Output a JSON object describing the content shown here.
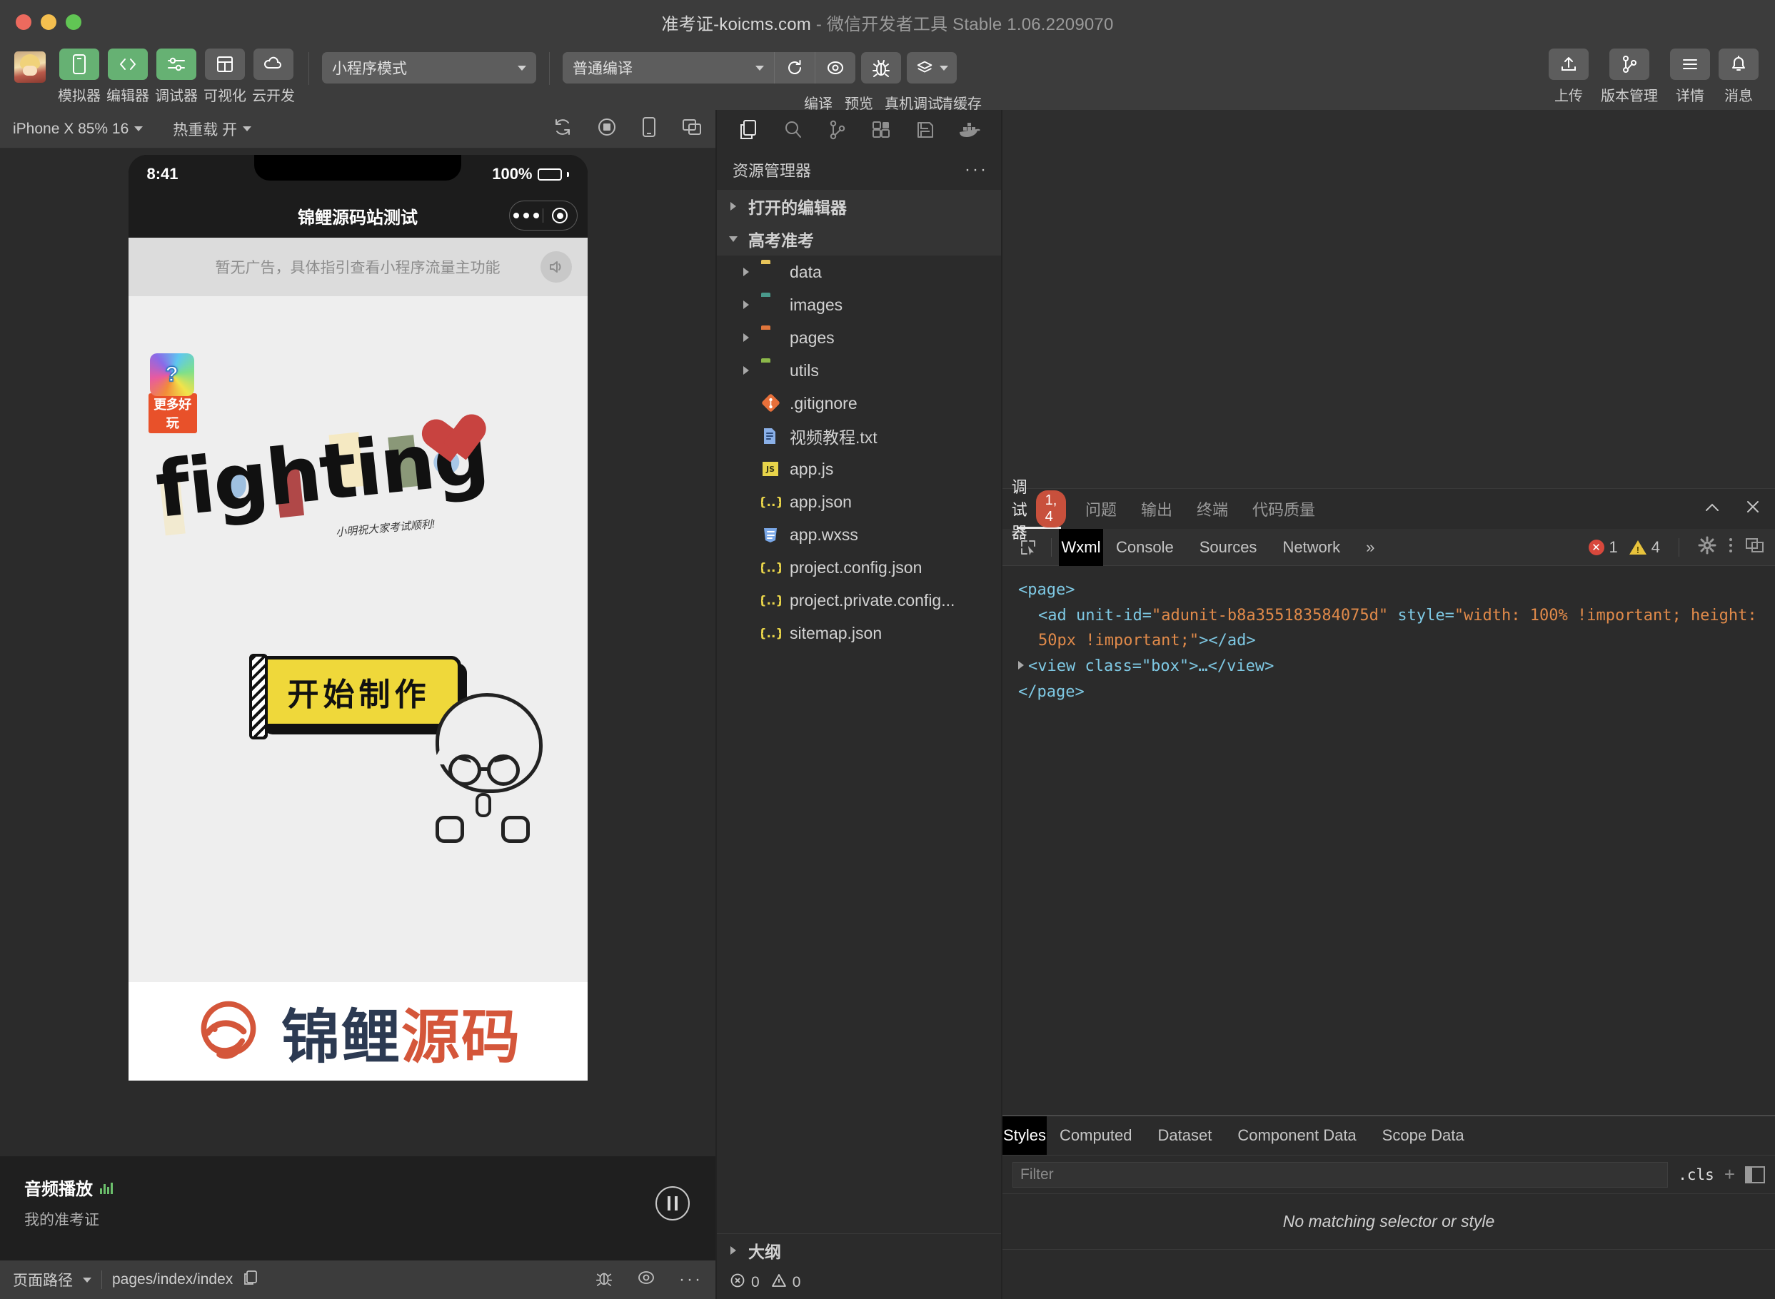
{
  "window": {
    "title_project": "准考证-koicms.com",
    "title_sep": " - ",
    "title_app": "微信开发者工具 Stable 1.06.2209070"
  },
  "toolbar": {
    "left_items": [
      {
        "label": "模拟器",
        "icon": "phone-icon",
        "style": "green"
      },
      {
        "label": "编辑器",
        "icon": "code-icon",
        "style": "green"
      },
      {
        "label": "调试器",
        "icon": "debug-icon",
        "style": "green"
      },
      {
        "label": "可视化",
        "icon": "layout-icon",
        "style": "grey"
      },
      {
        "label": "云开发",
        "icon": "cloud-icon",
        "style": "grey"
      }
    ],
    "mode_select": "小程序模式",
    "compile_select": "普通编译",
    "actions": [
      {
        "label": "编译",
        "icon": "refresh-icon"
      },
      {
        "label": "预览",
        "icon": "eye-icon"
      },
      {
        "label": "真机调试",
        "icon": "bug-icon"
      },
      {
        "label": "清缓存",
        "icon": "layers-icon"
      }
    ],
    "right_items": [
      {
        "label": "上传",
        "icon": "upload-icon"
      },
      {
        "label": "版本管理",
        "icon": "branch-icon"
      },
      {
        "label": "详情",
        "icon": "menu-icon"
      },
      {
        "label": "消息",
        "icon": "bell-icon"
      }
    ]
  },
  "simulator": {
    "device": "iPhone X 85% 16",
    "hot_reload": "热重载 开",
    "icons": [
      "rotate-icon",
      "record-icon",
      "device-icon",
      "window-icon"
    ],
    "phone": {
      "time": "8:41",
      "battery": "100%",
      "nav_title": "锦鲤源码站测试",
      "ad_text": "暂无广告，具体指引查看小程序流量主功能",
      "badge_label": "更多好玩",
      "fighting": "fighting",
      "subcaption": "小明祝大家考试顺利!",
      "start_button": "开始制作",
      "logo_dark": "锦鲤",
      "logo_orange": "源码"
    },
    "audio": {
      "title": "音频播放",
      "subtitle": "我的准考证",
      "control": "pause-icon"
    },
    "footer": {
      "path_label": "页面路径",
      "path_value": "pages/index/index",
      "icons": [
        "copy-icon",
        "bug-icon",
        "eye-icon",
        "more-icon"
      ]
    }
  },
  "explorer": {
    "activity_icons": [
      "files-icon",
      "search-icon",
      "source-control-icon",
      "extensions-icon",
      "save-icon",
      "docker-icon"
    ],
    "header": "资源管理器",
    "header_more": "···",
    "sections": [
      {
        "label": "打开的编辑器",
        "expanded": false
      },
      {
        "label": "高考准考",
        "expanded": true
      }
    ],
    "files": [
      {
        "name": "data",
        "type": "folder",
        "color": "#e8c45a",
        "expandable": true
      },
      {
        "name": "images",
        "type": "folder",
        "color": "#4a9a8c",
        "expandable": true
      },
      {
        "name": "pages",
        "type": "folder",
        "color": "#e0763c",
        "expandable": true
      },
      {
        "name": "utils",
        "type": "folder",
        "color": "#8cb84a",
        "expandable": true
      },
      {
        "name": ".gitignore",
        "type": "git",
        "color": "#e8703a",
        "expandable": false
      },
      {
        "name": "视频教程.txt",
        "type": "txt",
        "color": "#6a9ae0",
        "expandable": false
      },
      {
        "name": "app.js",
        "type": "js",
        "color": "#e8d44a",
        "expandable": false
      },
      {
        "name": "app.json",
        "type": "json",
        "color": "#e8d44a",
        "expandable": false
      },
      {
        "name": "app.wxss",
        "type": "css",
        "color": "#6a9ae0",
        "expandable": false
      },
      {
        "name": "project.config.json",
        "type": "json",
        "color": "#e8d44a",
        "expandable": false
      },
      {
        "name": "project.private.config...",
        "type": "json",
        "color": "#e8d44a",
        "expandable": false
      },
      {
        "name": "sitemap.json",
        "type": "json",
        "color": "#e8d44a",
        "expandable": false
      }
    ],
    "outline": "大纲",
    "status": {
      "errors": "0",
      "warnings": "0"
    }
  },
  "debugger": {
    "panel_tabs": [
      {
        "label": "调试器",
        "badge": "1, 4",
        "active": true
      },
      {
        "label": "问题",
        "badge": "",
        "active": false
      },
      {
        "label": "输出",
        "badge": "",
        "active": false
      },
      {
        "label": "终端",
        "badge": "",
        "active": false
      },
      {
        "label": "代码质量",
        "badge": "",
        "active": false
      }
    ],
    "collapse_icon": "chevron-up-icon",
    "close_icon": "close-icon",
    "dev_tabs": [
      {
        "label": "Wxml",
        "active": true
      },
      {
        "label": "Console",
        "active": false
      },
      {
        "label": "Sources",
        "active": false
      },
      {
        "label": "Network",
        "active": false
      }
    ],
    "more_tabs": "»",
    "error_count": "1",
    "warning_count": "4",
    "right_icons": [
      "gear-icon",
      "kebab-icon",
      "dock-icon"
    ],
    "code": {
      "line1": "<page>",
      "line2_a": "<ad unit-id=",
      "line2_b": "\"adunit-b8a355183584075d\"",
      "line2_c": " style=",
      "line2_d": "\"width: 100% !important; height: 50px !important;\"",
      "line2_e": "></ad>",
      "line3": "<view class=\"box\">…</view>",
      "line4": "</page>"
    },
    "styles": {
      "tabs": [
        {
          "label": "Styles",
          "active": true
        },
        {
          "label": "Computed",
          "active": false
        },
        {
          "label": "Dataset",
          "active": false
        },
        {
          "label": "Component Data",
          "active": false
        },
        {
          "label": "Scope Data",
          "active": false
        }
      ],
      "filter_placeholder": "Filter",
      "cls_label": ".cls",
      "plus_label": "+",
      "empty_message": "No matching selector or style"
    }
  },
  "colors": {
    "accent_green": "#66b173",
    "badge_red": "#c8503c",
    "error_red": "#d8483c",
    "warning_yellow": "#e8c33c",
    "window_bg": "#3c3c3c",
    "panel_bg": "#2b2b2b"
  }
}
